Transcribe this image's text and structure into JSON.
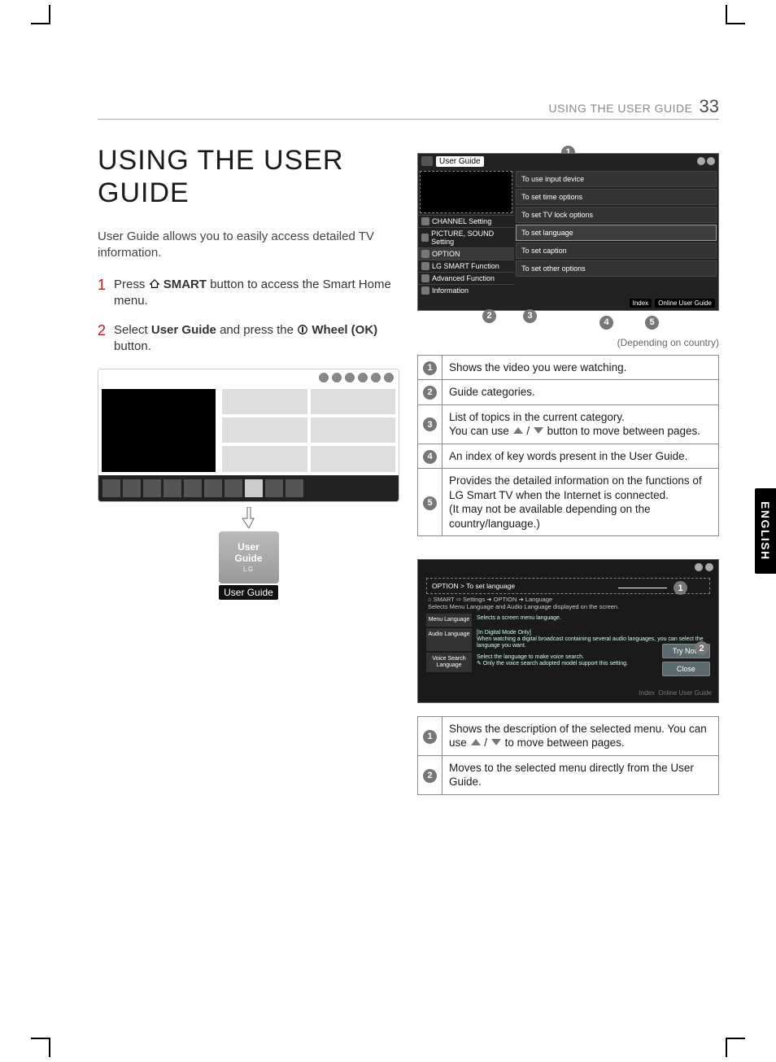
{
  "header": {
    "title": "USING THE USER GUIDE",
    "page": "33"
  },
  "h1": "USING THE USER\nGUIDE",
  "intro": "User Guide allows you to easily access detailed TV information.",
  "steps": {
    "1": {
      "n": "1",
      "pre": "Press ",
      "b1": "SMART",
      "post": " button to access the Smart Home menu."
    },
    "2": {
      "n": "2",
      "pre": "Select ",
      "b1": "User Guide",
      "mid": " and press the ",
      "b2": "Wheel (OK)",
      "post": " button."
    }
  },
  "appcard": {
    "l1": "User",
    "l2": "Guide",
    "brand": "LG",
    "label": "User Guide"
  },
  "scr1": {
    "title": "User Guide",
    "cats": [
      "CHANNEL Setting",
      "PICTURE, SOUND Setting",
      "OPTION",
      "LG SMART Function",
      "Advanced Function",
      "Information"
    ],
    "rows": [
      "To use input device",
      "To set time options",
      "To set TV lock options",
      "To set language",
      "To set caption",
      "To set other options"
    ],
    "foot": {
      "index": "Index",
      "online": "Online User Guide"
    }
  },
  "caption1": "(Depending on country)",
  "desc1": {
    "1": "Shows the video you were watching.",
    "2": "Guide categories.",
    "3": "List of topics in the current category.\nYou can use  /  button to move between pages.",
    "3_pre": "List of topics in the current category.\nYou can use ",
    "3_post": " button to move between pages.",
    "4": "An index of key words present in the User Guide.",
    "5": "Provides the detailed information on the functions of LG Smart TV when the Internet is connected.\n(It may not be available depending on the country/language.)"
  },
  "scr2": {
    "crumb": "OPTION > To set language",
    "path": "SMART ⇨ Settings ➜ OPTION ➜ Language",
    "sub": "Selects Menu Language and Audio Language displayed on the screen.",
    "rows": [
      {
        "l": "Menu Language",
        "r": "Selects a screen menu language."
      },
      {
        "l": "Audio Language",
        "r": "[In Digital Mode Only]\nWhen watching a digital broadcast containing several audio languages, you can select the language you want."
      },
      {
        "l": "Voice Search Language",
        "r": "Select the language to make voice search.\n✎ Only the voice search adopted model support this setting."
      }
    ],
    "btn1": "Try Now",
    "btn2": "Close",
    "foot": {
      "index": "Index",
      "online": "Online User Guide"
    }
  },
  "desc2": {
    "1_pre": "Shows the description of the selected menu. You can use ",
    "1_post": " to move between pages.",
    "2": "Moves to the selected menu directly from the User Guide."
  },
  "lang": "ENGLISH",
  "nums": {
    "1": "1",
    "2": "2",
    "3": "3",
    "4": "4",
    "5": "5"
  }
}
